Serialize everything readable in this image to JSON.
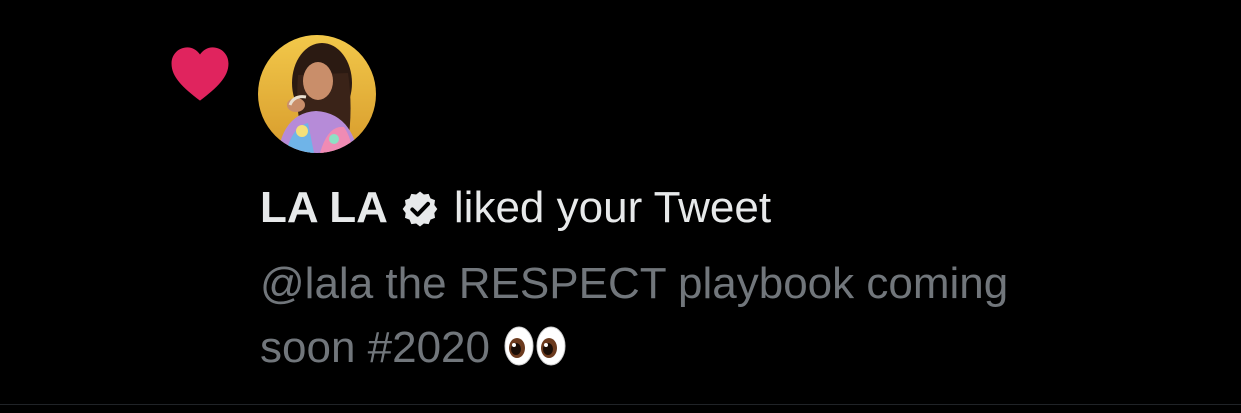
{
  "notification": {
    "type_icon": "heart-icon",
    "heart_color": "#f91880",
    "avatar": "profile-photo",
    "user_name": "LA LA",
    "verified_icon": "verified-badge-icon",
    "action_text": "liked your Tweet",
    "tweet_line_1": "@lala the RESPECT playbook coming",
    "tweet_line_2": "soon #2020",
    "emoji": "eyes-emoji"
  },
  "colors": {
    "background": "#000000",
    "primary_text": "#e7e9ea",
    "secondary_text": "#71767b"
  }
}
